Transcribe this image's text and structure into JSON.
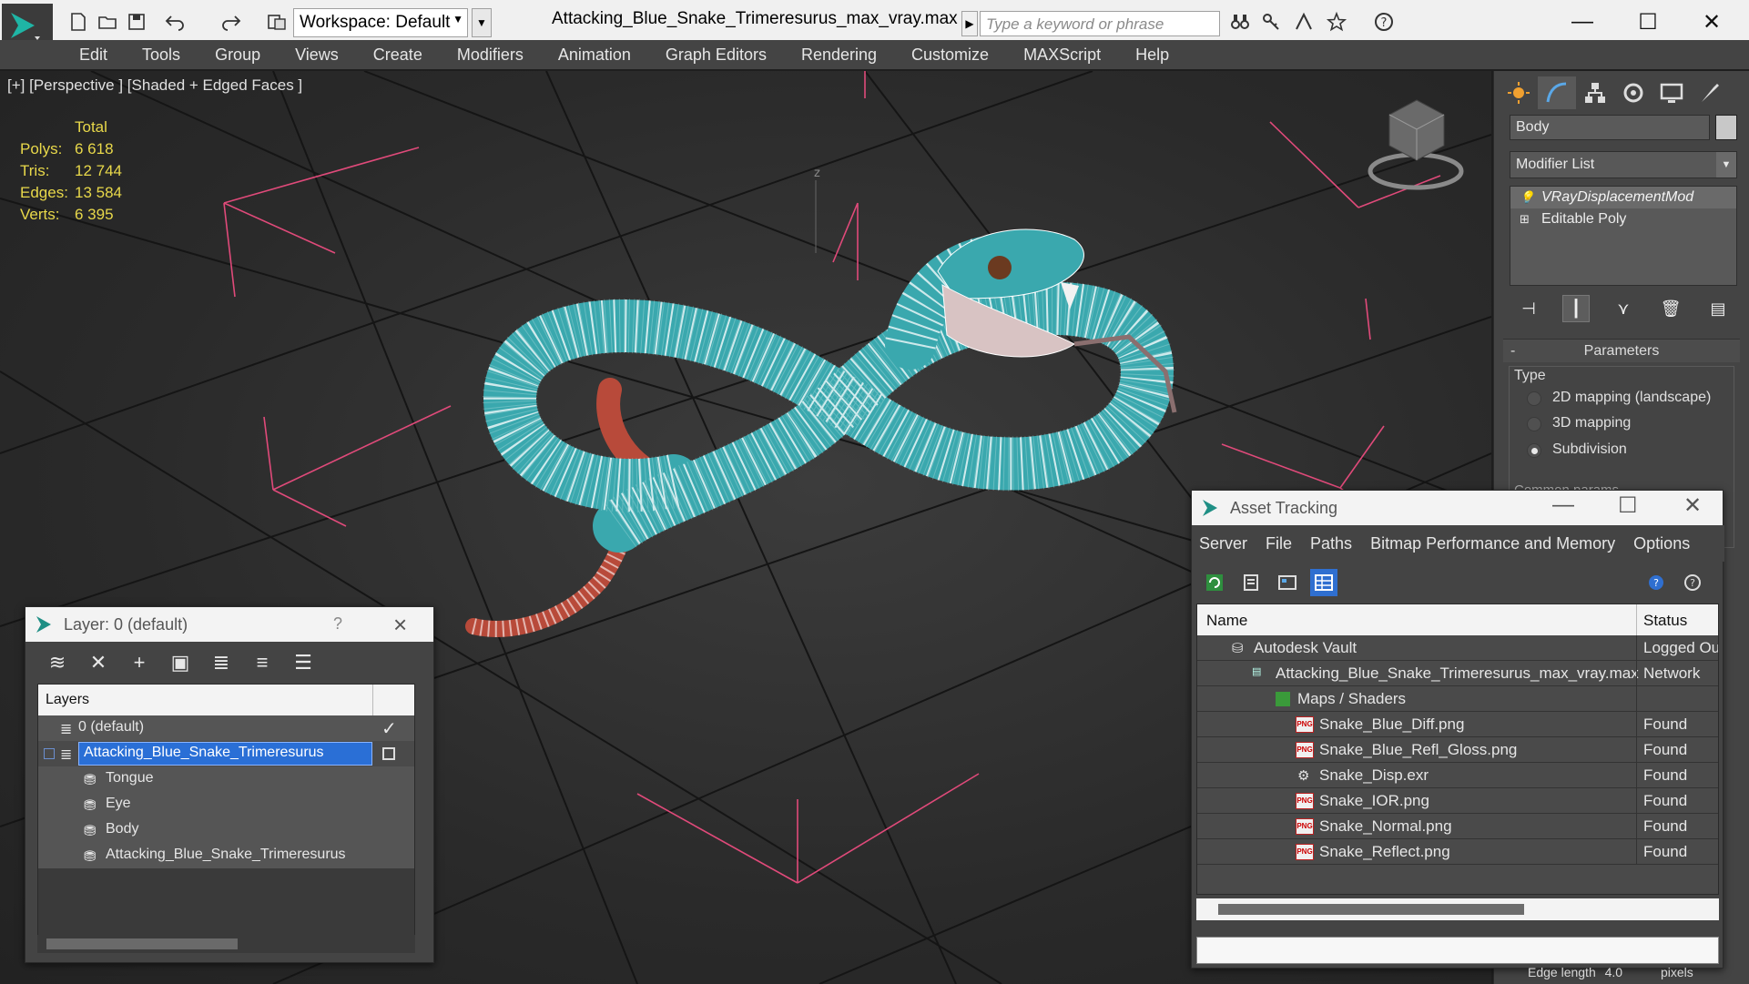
{
  "titlebar": {
    "workspace": "Workspace: Default",
    "document_title": "Attacking_Blue_Snake_Trimeresurus_max_vray.max",
    "search_placeholder": "Type a keyword or phrase"
  },
  "menubar": [
    "Edit",
    "Tools",
    "Group",
    "Views",
    "Create",
    "Modifiers",
    "Animation",
    "Graph Editors",
    "Rendering",
    "Customize",
    "MAXScript",
    "Help"
  ],
  "viewport": {
    "label": "[+] [Perspective ] [Shaded + Edged Faces ]",
    "stats": {
      "header": "Total",
      "rows": [
        {
          "k": "Polys:",
          "v": "6 618"
        },
        {
          "k": "Tris:",
          "v": "12 744"
        },
        {
          "k": "Edges:",
          "v": "13 584"
        },
        {
          "k": "Verts:",
          "v": "6 395"
        }
      ]
    },
    "axis_label": "z",
    "colors": {
      "mesh": "#3aa8ae",
      "wire": "#ffffff",
      "grid": "#111111",
      "bbox": "#e04a7a",
      "tail": "#b84a3a"
    }
  },
  "command_panel": {
    "object_name": "Body",
    "modifier_list": "Modifier List",
    "stack": [
      "VRayDisplacementMod",
      "Editable Poly"
    ],
    "parameters_title": "Parameters",
    "type_label": "Type",
    "type_options": [
      "2D mapping (landscape)",
      "3D mapping",
      "Subdivision"
    ],
    "type_selected": "Subdivision",
    "common_params": "Common params"
  },
  "layer_window": {
    "title": "Layer: 0 (default)",
    "help": "?",
    "column": "Layers",
    "rows": [
      {
        "name": "0 (default)"
      },
      {
        "name": "Attacking_Blue_Snake_Trimeresurus"
      },
      {
        "name": "Tongue"
      },
      {
        "name": "Eye"
      },
      {
        "name": "Body"
      },
      {
        "name": "Attacking_Blue_Snake_Trimeresurus"
      }
    ]
  },
  "asset_window": {
    "title": "Asset Tracking",
    "menu": [
      "Server",
      "File",
      "Paths",
      "Bitmap Performance and Memory",
      "Options"
    ],
    "col_name": "Name",
    "col_status": "Status",
    "rows": [
      {
        "name": "Autodesk Vault",
        "status": "Logged Out"
      },
      {
        "name": "Attacking_Blue_Snake_Trimeresurus_max_vray.max",
        "status": "Network"
      },
      {
        "name": "Maps / Shaders",
        "status": ""
      },
      {
        "name": "Snake_Blue_Diff.png",
        "status": "Found"
      },
      {
        "name": "Snake_Blue_Refl_Gloss.png",
        "status": "Found"
      },
      {
        "name": "Snake_Disp.exr",
        "status": "Found"
      },
      {
        "name": "Snake_IOR.png",
        "status": "Found"
      },
      {
        "name": "Snake_Normal.png",
        "status": "Found"
      },
      {
        "name": "Snake_Reflect.png",
        "status": "Found"
      }
    ]
  },
  "statusbar": {
    "edge_length": "Edge length",
    "edge_value": "4.0",
    "pixels": "pixels"
  }
}
